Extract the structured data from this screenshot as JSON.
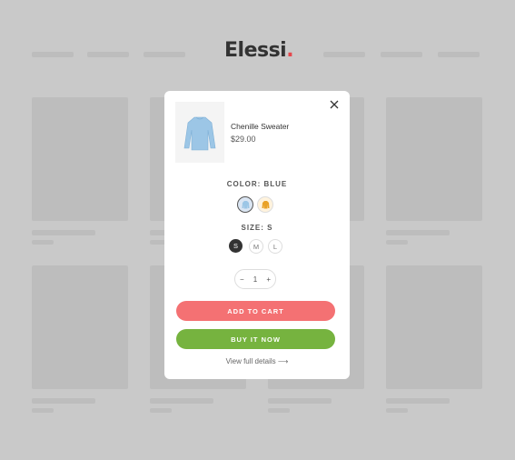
{
  "brand": {
    "name": "Elessi",
    "dot": ".",
    "accent": "#e5484d"
  },
  "product": {
    "name": "Chenille Sweater",
    "price": "$29.00"
  },
  "color_option": {
    "label": "COLOR: BLUE",
    "options": [
      "blue",
      "orange"
    ]
  },
  "size_option": {
    "label": "SIZE: S",
    "sizes": [
      "S",
      "M",
      "L"
    ],
    "selected": "S"
  },
  "quantity": {
    "minus": "−",
    "value": "1",
    "plus": "+"
  },
  "buttons": {
    "add_to_cart": "ADD TO CART",
    "buy_now": "BUY IT NOW",
    "add_color": "#f47173",
    "buy_color": "#76b33f"
  },
  "link": {
    "view_details": "View full details ⟶"
  }
}
